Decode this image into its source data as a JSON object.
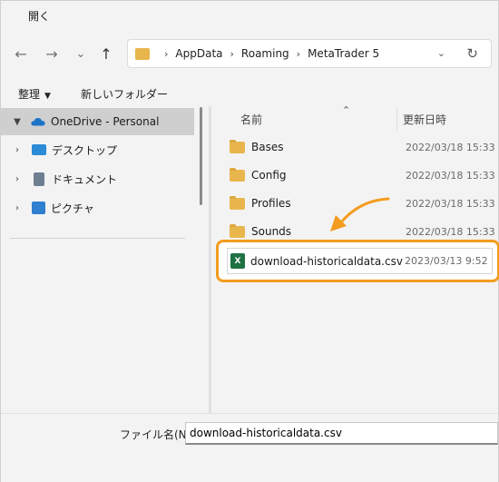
{
  "window": {
    "title": "開く"
  },
  "nav": {
    "back_icon": "←",
    "forward_icon": "→",
    "recent_icon": "⌄",
    "up_icon": "↑",
    "path": [
      "AppData",
      "Roaming",
      "MetaTrader 5"
    ],
    "separator": "›",
    "refresh_icon": "↻",
    "dropdown_icon": "⌄"
  },
  "commands": {
    "organize": "整理",
    "new_folder": "新しいフォルダー"
  },
  "sidebar": {
    "items": [
      {
        "label": "OneDrive - Personal",
        "expanded": true,
        "selected": true
      },
      {
        "label": "デスクトップ"
      },
      {
        "label": "ドキュメント"
      },
      {
        "label": "ピクチャ"
      }
    ]
  },
  "columns": {
    "name": "名前",
    "modified": "更新日時"
  },
  "files": [
    {
      "name": "Bases",
      "date": "2022/03/18 15:33",
      "type": "folder"
    },
    {
      "name": "Config",
      "date": "2022/03/18 15:33",
      "type": "folder"
    },
    {
      "name": "Profiles",
      "date": "2022/03/18 15:33",
      "type": "folder"
    },
    {
      "name": "Sounds",
      "date": "2022/03/18 15:33",
      "type": "folder"
    },
    {
      "name": "download-historicaldata.csv",
      "date": "2023/03/13 9:52",
      "type": "csv",
      "highlighted": true
    }
  ],
  "filename": {
    "label": "ファイル名(N):",
    "value": "download-historicaldata.csv"
  },
  "colors": {
    "highlight": "#f39c1f",
    "folder": "#e8b64d",
    "excel": "#1f7244",
    "onedrive": "#1e73c8"
  }
}
